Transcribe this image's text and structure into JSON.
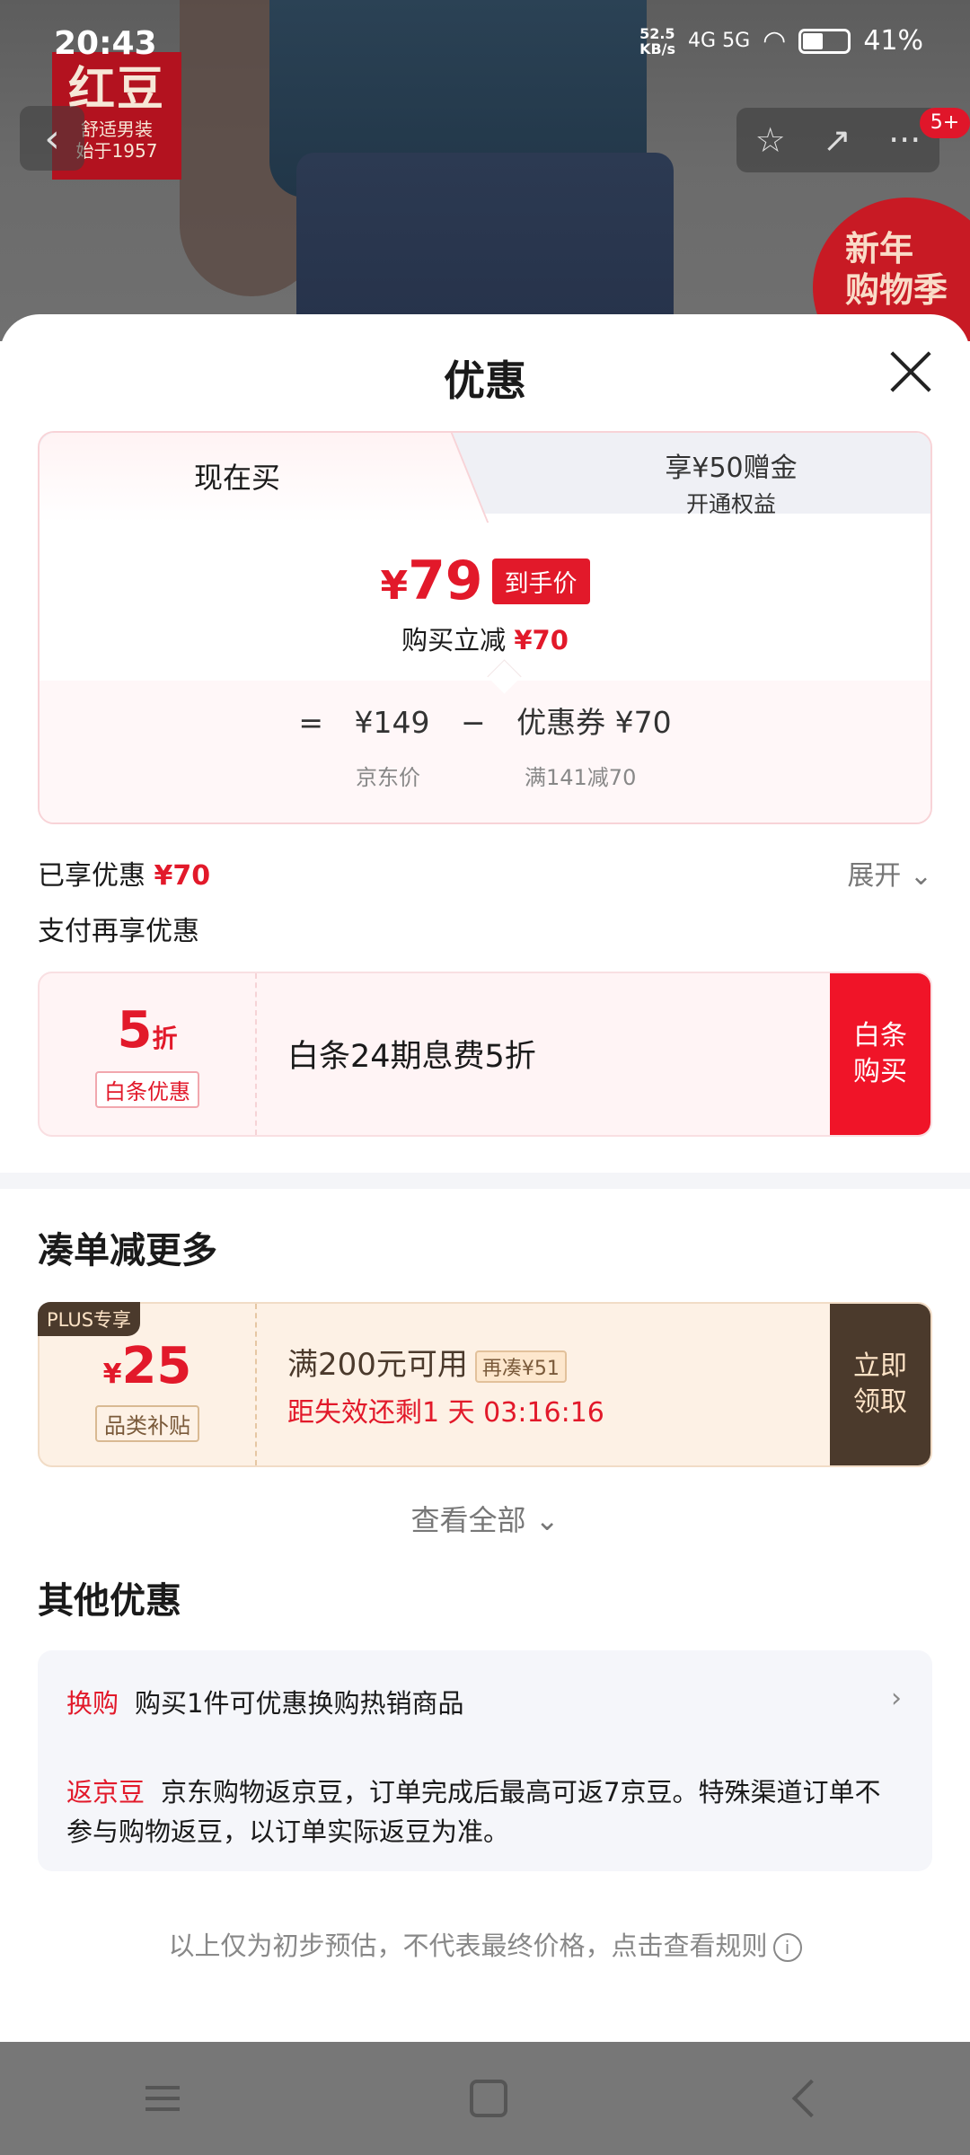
{
  "statusbar": {
    "time": "20:43",
    "netspeed_top": "52.5",
    "netspeed_bottom": "KB/s",
    "network": "4G 5G",
    "battery": "41%"
  },
  "background": {
    "brand_name": "红豆",
    "brand_slogan_1": "舒适男装",
    "brand_slogan_2": "始于1957",
    "promo_line1": "新年",
    "promo_line2": "购物季",
    "badge": "5+"
  },
  "sheet": {
    "title": "优惠",
    "tabs": {
      "now": "现在买",
      "plus_line1": "享¥50赠金",
      "plus_line2": "开通权益"
    },
    "final_price": "79",
    "currency": "¥",
    "final_price_tag": "到手价",
    "reduce_label": "购买立减",
    "reduce_value": "¥70",
    "calc": {
      "equals": "=",
      "jd_price": "¥149",
      "minus": "−",
      "coupon": "优惠券 ¥70",
      "jd_price_label": "京东价",
      "coupon_rule": "满141减70"
    },
    "enjoyed_label": "已享优惠",
    "enjoyed_value": "¥70",
    "expand_label": "展开",
    "pay_more_label": "支付再享优惠",
    "baitiao": {
      "discount_num": "5",
      "discount_unit": "折",
      "tag": "白条优惠",
      "text": "白条24期息费5折",
      "button_line1": "白条",
      "button_line2": "购买"
    },
    "bundle_title": "凑单减更多",
    "plus_coupon": {
      "badge": "PLUS专享",
      "amount": "25",
      "tag": "品类补贴",
      "condition": "满200元可用",
      "chip": "再凑¥51",
      "countdown": "距失效还剩1 天 03:16:16",
      "button_line1": "立即",
      "button_line2": "领取"
    },
    "view_all": "查看全部",
    "other_title": "其他优惠",
    "other": {
      "swap_label": "换购",
      "swap_text": "购买1件可优惠换购热销商品",
      "bean_label": "返京豆",
      "bean_text": "京东购物返京豆，订单完成后最高可返7京豆。特殊渠道订单不参与购物返豆，以订单实际返豆为准。"
    },
    "footnote": "以上仅为初步预估，不代表最终价格，点击查看规则"
  },
  "colors": {
    "accent_red": "#e2192a",
    "plus_brown": "#4b3a2c"
  }
}
